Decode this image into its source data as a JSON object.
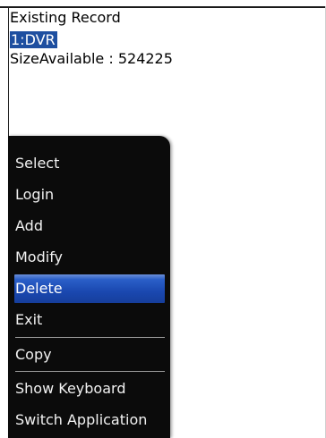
{
  "screen": {
    "title": "Existing Record",
    "selected_record": "1:DVR",
    "size_available": "SizeAvailable : 524225"
  },
  "menu": {
    "items": [
      {
        "label": "Select"
      },
      {
        "label": "Login"
      },
      {
        "label": "Add"
      },
      {
        "label": "Modify"
      },
      {
        "label": "Delete",
        "selected": true
      },
      {
        "label": "Exit"
      },
      {
        "label": "Copy"
      },
      {
        "label": "Show Keyboard"
      },
      {
        "label": "Switch Application"
      }
    ]
  },
  "colors": {
    "background": "#ffffff",
    "menu_background": "#0b0b0b",
    "menu_text": "#f2f2f2",
    "selection_blue": "#1e4fa0"
  }
}
